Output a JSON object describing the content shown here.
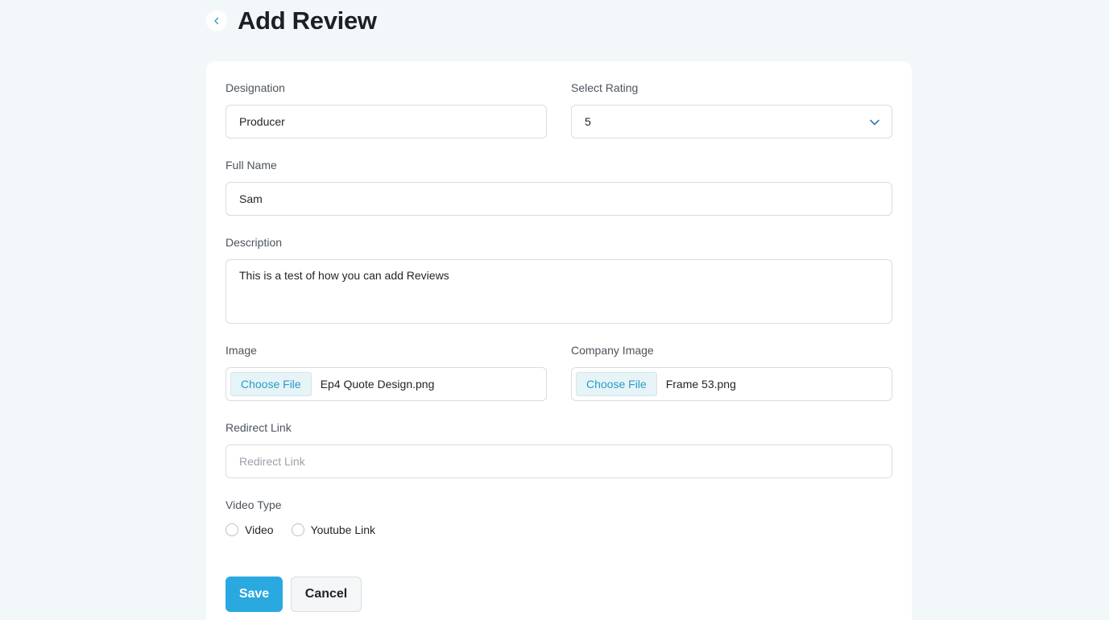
{
  "header": {
    "title": "Add Review",
    "back_icon": "chevron-left-icon"
  },
  "form": {
    "designation": {
      "label": "Designation",
      "value": "Producer"
    },
    "rating": {
      "label": "Select Rating",
      "value": "5",
      "icon": "chevron-down-icon"
    },
    "full_name": {
      "label": "Full Name",
      "value": "Sam"
    },
    "description": {
      "label": "Description",
      "value": "This is a test of how you can add Reviews"
    },
    "image": {
      "label": "Image",
      "button_label": "Choose File",
      "file_name": "Ep4 Quote Design.png"
    },
    "company_image": {
      "label": "Company Image",
      "button_label": "Choose File",
      "file_name": "Frame 53.png"
    },
    "redirect_link": {
      "label": "Redirect Link",
      "placeholder": "Redirect Link",
      "value": ""
    },
    "video_type": {
      "label": "Video Type",
      "options": [
        {
          "label": "Video",
          "selected": false
        },
        {
          "label": "Youtube Link",
          "selected": false
        }
      ]
    }
  },
  "actions": {
    "save_label": "Save",
    "cancel_label": "Cancel"
  },
  "colors": {
    "accent": "#2aa9e0",
    "background": "#f2f7fa",
    "link": "#2a9bc5"
  }
}
